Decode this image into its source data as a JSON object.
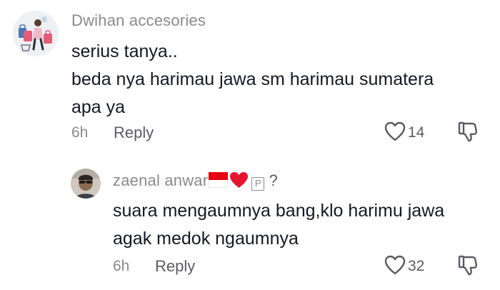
{
  "comment1": {
    "username": "Dwihan accesories",
    "lines": [
      "serius tanya..",
      "beda nya harimau jawa sm harimau sumatera",
      "apa ya"
    ],
    "time": "6h",
    "reply_label": "Reply",
    "likes": "14"
  },
  "comment2": {
    "username": "zaenal anwar",
    "badge": "P",
    "question": "?",
    "lines": [
      "suara mengaumnya bang,klo harimu jawa",
      "agak medok ngaumnya"
    ],
    "time": "6h",
    "reply_label": "Reply",
    "likes": "32"
  },
  "colors": {
    "username": "#8a8a8a",
    "text": "#161823",
    "heart_emoji": "#e8132d"
  }
}
